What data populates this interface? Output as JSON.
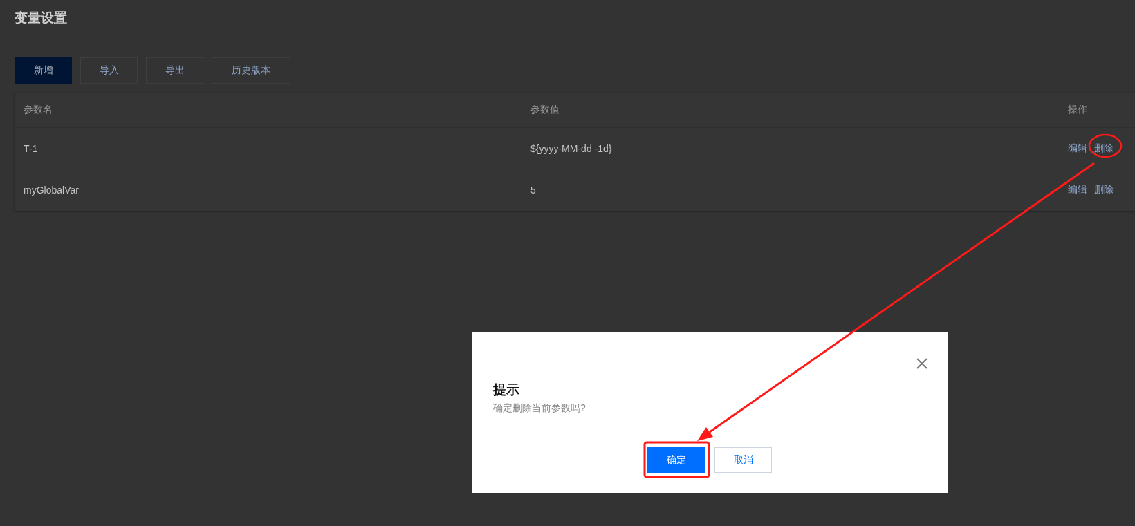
{
  "page": {
    "title": "变量设置"
  },
  "toolbar": [
    {
      "label": "新增",
      "kind": "primary"
    },
    {
      "label": "导入",
      "kind": "default"
    },
    {
      "label": "导出",
      "kind": "default"
    },
    {
      "label": "历史版本",
      "kind": "default"
    }
  ],
  "table": {
    "columns": [
      "参数名",
      "参数值",
      "操作"
    ],
    "rows": [
      {
        "name": "T-1",
        "value": "${yyyy-MM-dd -1d}",
        "actions": [
          "编辑",
          "删除"
        ]
      },
      {
        "name": "myGlobalVar",
        "value": "5",
        "actions": [
          "编辑",
          "删除"
        ]
      }
    ]
  },
  "dialog": {
    "title": "提示",
    "message": "确定删除当前参数吗?",
    "buttons": [
      {
        "label": "确定",
        "kind": "primary"
      },
      {
        "label": "取消",
        "kind": "default"
      }
    ]
  }
}
